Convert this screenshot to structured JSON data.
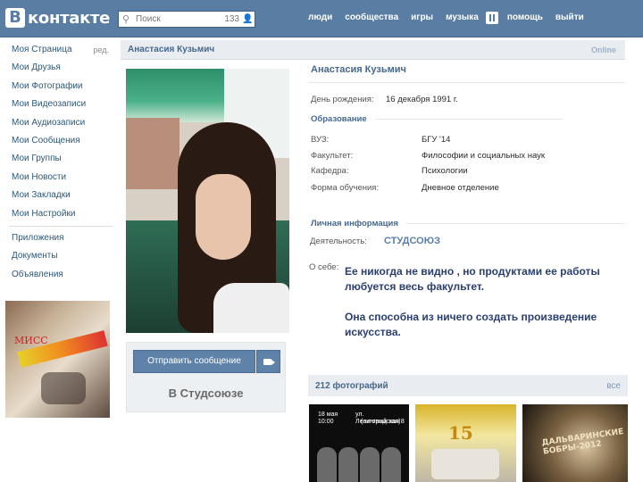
{
  "header": {
    "logo_letter": "В",
    "logo_text": "контакте",
    "search_placeholder": "Поиск",
    "search_count": "133",
    "nav": [
      "люди",
      "сообщества",
      "игры",
      "музыка",
      "помощь",
      "выйти"
    ]
  },
  "left_menu": {
    "items": [
      {
        "label": "Моя Страница",
        "edit": "ред."
      },
      {
        "label": "Мои Друзья"
      },
      {
        "label": "Мои Фотографии"
      },
      {
        "label": "Мои Видеозаписи"
      },
      {
        "label": "Мои Аудиозаписи"
      },
      {
        "label": "Мои Сообщения"
      },
      {
        "label": "Мои Группы"
      },
      {
        "label": "Мои Новости"
      },
      {
        "label": "Мои Закладки"
      },
      {
        "label": "Мои Настройки"
      }
    ],
    "extra": [
      "Приложения",
      "Документы",
      "Объявления"
    ],
    "ad_text": "МИСС"
  },
  "profile": {
    "header_name": "Анастасия Кузьмич",
    "status": "Online",
    "full_name": "Анастасия  Кузьмич",
    "send_message": "Отправить сообщение",
    "group_label": "В Студсоюзе",
    "birthday_label": "День рождения:",
    "birthday_value": "16 декабря 1991 г.",
    "education_title": "Образование",
    "education": [
      {
        "label": "ВУЗ:",
        "value": "БГУ '14"
      },
      {
        "label": "Факультет:",
        "value": "Философии и социальных наук"
      },
      {
        "label": "Кафедра:",
        "value": "Психологии"
      },
      {
        "label": "Форма обучения:",
        "value": "Дневное отделение"
      }
    ],
    "personal_title": "Личная информация",
    "activity_label": "Деятельность:",
    "activity_value": "СТУДСОЮЗ",
    "about_label": "О себе:",
    "about_line1": "Ее никогда не видно , но продуктами ее работы любуется весь факультет.",
    "about_line2": "Она способна из ничего создать произведение искусства."
  },
  "photos": {
    "title": "212 фотографий",
    "all": "все",
    "thumb1_lines": [
      "18 мая",
      "10:00",
      "ул. Ленинградская 8",
      "(актовый зал)"
    ],
    "thumb2_text": "15",
    "thumb3_text": "ДАЛЬВАРИНСКИЕ БОБРЫ-2012"
  }
}
